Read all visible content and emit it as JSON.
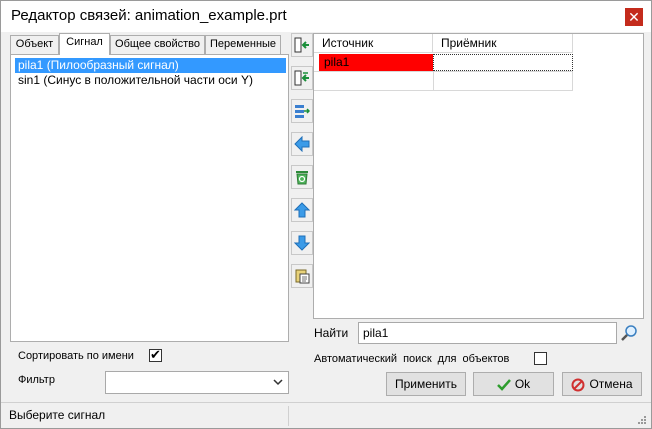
{
  "window": {
    "title": "Редактор связей:  animation_example.prt",
    "close_glyph": "✕"
  },
  "tabs": [
    {
      "label": "Объект",
      "active": false
    },
    {
      "label": "Сигнал",
      "active": true
    },
    {
      "label": "Общее свойство",
      "active": false
    },
    {
      "label": "Переменные",
      "active": false
    }
  ],
  "signals": [
    {
      "label": "pila1  (Пилообразный сигнал)",
      "selected": true
    },
    {
      "label": "sin1  (Синус в положительной части оси Y)",
      "selected": false
    }
  ],
  "toolbar": [
    {
      "icon": "link-in-icon"
    },
    {
      "icon": "link-out-icon"
    },
    {
      "icon": "link-insert-icon"
    },
    {
      "icon": "arrow-left-icon"
    },
    {
      "icon": "recycle-bin-icon"
    },
    {
      "icon": "arrow-up-icon"
    },
    {
      "icon": "arrow-down-icon"
    },
    {
      "icon": "paste-icon"
    }
  ],
  "grid": {
    "columns": [
      "Источник",
      "Приёмник"
    ],
    "rows": [
      {
        "source": "pila1",
        "target": ""
      }
    ],
    "colors": {
      "source_highlight": "#ff0000"
    }
  },
  "find": {
    "label": "Найти",
    "value": "pila1"
  },
  "auto_search": {
    "label": "Автоматический поиск для объектов",
    "checked": false
  },
  "sort": {
    "label": "Сортировать по имени",
    "checked": true
  },
  "filter": {
    "label": "Фильтр",
    "value": ""
  },
  "buttons": {
    "apply": "Применить",
    "ok": "Ok",
    "cancel": "Отмена"
  },
  "status": {
    "text": "Выберите сигнал"
  },
  "colors": {
    "selection": "#3399ff",
    "close": "#c42b1c",
    "ok_check": "#2e9d2e",
    "cancel_icon": "#d03030"
  }
}
